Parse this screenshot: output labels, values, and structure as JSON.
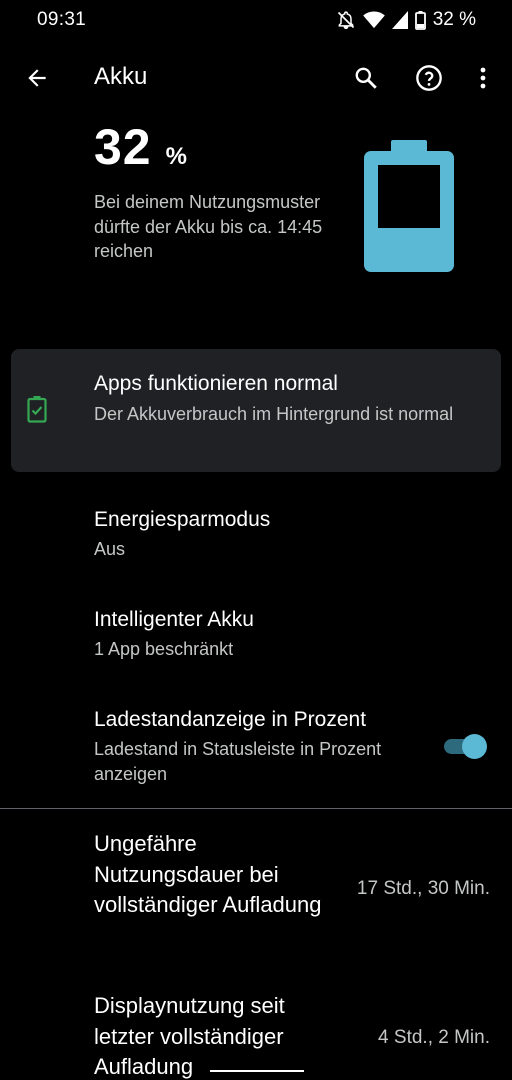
{
  "status_bar": {
    "time": "09:31",
    "battery_text": "32 %",
    "icons": [
      "bell-off-icon",
      "wifi-icon",
      "cell-signal-icon",
      "battery-icon"
    ]
  },
  "app_bar": {
    "title": "Akku",
    "icons": [
      "back-arrow-icon",
      "search-icon",
      "help-icon",
      "more-vert-icon"
    ]
  },
  "battery": {
    "percent": "32",
    "unit": "%",
    "estimate": "Bei deinem Nutzungsmuster dürfte der Akku bis ca. 14:45 reichen",
    "level": 0.32,
    "color": "#5bb9d6"
  },
  "tip": {
    "title": "Apps funktionieren normal",
    "description": "Der Akkuverbrauch im Hintergrund ist normal",
    "icon": "battery-check-icon",
    "icon_color": "#34a853"
  },
  "settings": [
    {
      "title": "Energiesparmodus",
      "subtitle": "Aus"
    },
    {
      "title": "Intelligenter Akku",
      "subtitle": "1 App beschränkt"
    },
    {
      "title": "Ladestandanzeige in Prozent",
      "subtitle": "Ladestand in Statusleiste in Prozent anzeigen",
      "toggle_on": true
    }
  ],
  "usage": [
    {
      "label": "Ungefähre Nutzungsdauer bei vollständiger Aufladung",
      "value": "17 Std., 30 Min."
    },
    {
      "label": "Displaynutzung seit letzter vollständiger Aufladung",
      "value": "4 Std., 2 Min."
    }
  ],
  "colors": {
    "background": "#000000",
    "card": "#202124",
    "secondary_text": "#c4c7c5",
    "accent": "#5bb9d6"
  }
}
